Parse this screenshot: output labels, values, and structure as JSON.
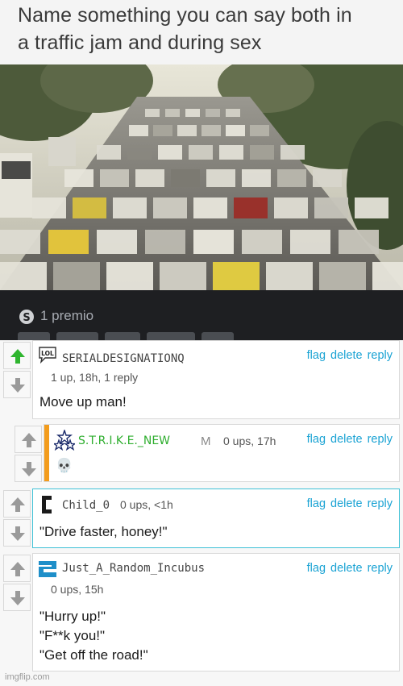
{
  "meme": {
    "title_line1": "Name something you can say both in",
    "title_line2": "a traffic jam and during sex"
  },
  "award": {
    "icon": "award-icon",
    "label": "1 premio"
  },
  "comments": [
    {
      "username": "SERIALDESIGNATIONQ",
      "avatar": "lol-speech-icon",
      "meta": "1 up, 18h, 1 reply",
      "body": "Move up man!",
      "upvoted": true,
      "flag": "flag",
      "delete": "delete",
      "reply": "reply"
    },
    {
      "username": "S.T.R.I.K.E._NEW",
      "avatar": "stars-icon",
      "badge": "M",
      "meta": "0 ups, 17h",
      "body": "💀",
      "flag": "flag",
      "delete": "delete",
      "reply": "reply"
    },
    {
      "username": "Child_0",
      "avatar": "bracket-icon",
      "meta": "0 ups, <1h",
      "body": "\"Drive faster, honey!\"",
      "flag": "flag",
      "delete": "delete",
      "reply": "reply"
    },
    {
      "username": "Just_A_Random_Incubus",
      "avatar": "number-2-icon",
      "meta": "0 ups, 15h",
      "body_lines": [
        "\"Hurry up!\"",
        "\"F**k you!\"",
        "\"Get off the road!\""
      ],
      "flag": "flag",
      "delete": "delete",
      "reply": "reply"
    }
  ],
  "watermark": "imgflip.com",
  "colors": {
    "upvote_active": "#2fb52f",
    "link": "#1ba3d4",
    "mod_bar": "#f39c1c",
    "focus_border": "#3fc1d6",
    "username_green": "#2fae2f"
  }
}
